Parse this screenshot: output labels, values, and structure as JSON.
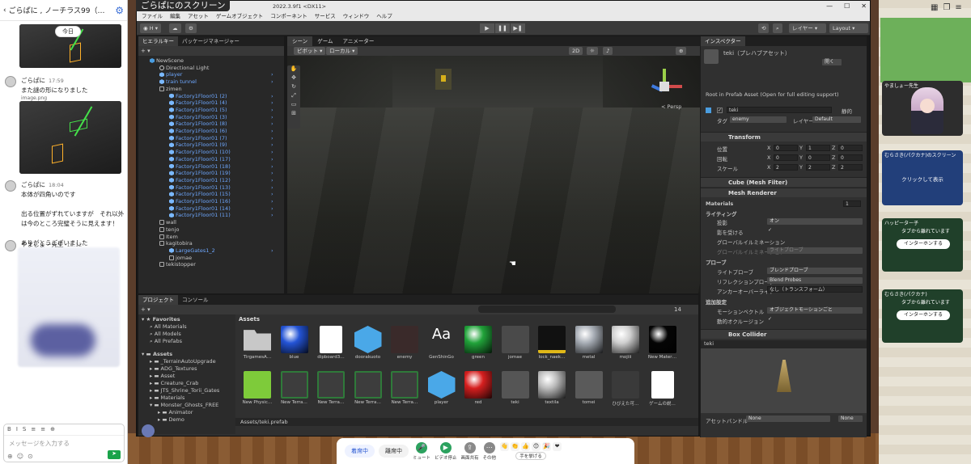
{
  "chat": {
    "title": "ごらぱに , ノーチラス99（…",
    "date_badge": "今日",
    "messages": [
      {
        "name": "ごらぱに",
        "time": "17:59",
        "text": "また謎の形になりました",
        "attachment": "image.png"
      },
      {
        "name": "ごらぱに",
        "time": "18:04",
        "text": "本体が四角いのです\n\n出る位置がずれていますが　それ以外は今のところ完璧そうに見えます！\n\nありがとうございました"
      },
      {
        "name": "やましょー先生",
        "time": "18:12",
        "text": ""
      }
    ],
    "composer": {
      "placeholder": "メッセージを入力する",
      "toolbar": [
        "B",
        "I",
        "S",
        "≡",
        "≡",
        "⊕"
      ]
    }
  },
  "screen_share_label": "ごらぱにのスクリーン",
  "unity": {
    "title": "2022.3.9f1 <DX11>",
    "menu": [
      "ファイル",
      "編集",
      "アセット",
      "ゲームオブジェクト",
      "コンポーネント",
      "サービス",
      "ウィンドウ",
      "ヘルプ"
    ],
    "toolbar": {
      "account": "H",
      "layers": "レイヤー",
      "layout": "Layout"
    },
    "hierarchy": {
      "tab": "ヒエラルキー",
      "tab2": "パッケージマネージャー",
      "rows": [
        {
          "text": "NewScene",
          "icon": "cube",
          "indent": 0,
          "color": "white"
        },
        {
          "text": "Directional Light",
          "icon": "light",
          "indent": 1,
          "color": "white"
        },
        {
          "text": "player",
          "icon": "prefab",
          "indent": 1,
          "color": "blue"
        },
        {
          "text": "train tunnel",
          "icon": "prefab",
          "indent": 1,
          "color": "blue"
        },
        {
          "text": "zimen",
          "icon": "go",
          "indent": 1,
          "color": "white"
        },
        {
          "text": "Factory1Floor01 (2)",
          "icon": "prefab",
          "indent": 2,
          "color": "blue"
        },
        {
          "text": "Factory1Floor01 (4)",
          "icon": "prefab",
          "indent": 2,
          "color": "blue"
        },
        {
          "text": "Factory1Floor01 (5)",
          "icon": "prefab",
          "indent": 2,
          "color": "blue"
        },
        {
          "text": "Factory1Floor01 (3)",
          "icon": "prefab",
          "indent": 2,
          "color": "blue"
        },
        {
          "text": "Factory1Floor01 (8)",
          "icon": "prefab",
          "indent": 2,
          "color": "blue"
        },
        {
          "text": "Factory1Floor01 (6)",
          "icon": "prefab",
          "indent": 2,
          "color": "blue"
        },
        {
          "text": "Factory1Floor01 (7)",
          "icon": "prefab",
          "indent": 2,
          "color": "blue"
        },
        {
          "text": "Factory1Floor01 (9)",
          "icon": "prefab",
          "indent": 2,
          "color": "blue"
        },
        {
          "text": "Factory1Floor01 (10)",
          "icon": "prefab",
          "indent": 2,
          "color": "blue"
        },
        {
          "text": "Factory1Floor01 (17)",
          "icon": "prefab",
          "indent": 2,
          "color": "blue"
        },
        {
          "text": "Factory1Floor01 (18)",
          "icon": "prefab",
          "indent": 2,
          "color": "blue"
        },
        {
          "text": "Factory1Floor01 (19)",
          "icon": "prefab",
          "indent": 2,
          "color": "blue"
        },
        {
          "text": "Factory1Floor01 (12)",
          "icon": "prefab",
          "indent": 2,
          "color": "blue"
        },
        {
          "text": "Factory1Floor01 (13)",
          "icon": "prefab",
          "indent": 2,
          "color": "blue"
        },
        {
          "text": "Factory1Floor01 (15)",
          "icon": "prefab",
          "indent": 2,
          "color": "blue"
        },
        {
          "text": "Factory1Floor01 (16)",
          "icon": "prefab",
          "indent": 2,
          "color": "blue"
        },
        {
          "text": "Factory1Floor01 (14)",
          "icon": "prefab",
          "indent": 2,
          "color": "blue"
        },
        {
          "text": "Factory1Floor01 (11)",
          "icon": "prefab",
          "indent": 2,
          "color": "blue"
        },
        {
          "text": "wall",
          "icon": "go",
          "indent": 1,
          "color": "white"
        },
        {
          "text": "tenjo",
          "icon": "go",
          "indent": 1,
          "color": "white"
        },
        {
          "text": "Item",
          "icon": "go",
          "indent": 1,
          "color": "white"
        },
        {
          "text": "kagitobira",
          "icon": "go",
          "indent": 1,
          "color": "white"
        },
        {
          "text": "LargeGates1_2",
          "icon": "prefab",
          "indent": 2,
          "color": "blue"
        },
        {
          "text": "jomae",
          "icon": "go",
          "indent": 2,
          "color": "white"
        },
        {
          "text": "tekistopper",
          "icon": "go",
          "indent": 1,
          "color": "white"
        }
      ]
    },
    "scene": {
      "tab": "シーン",
      "tab2": "ゲーム",
      "tab3": "アニメーター",
      "pivot": "ピボット",
      "local": "ローカル",
      "mode": "2D",
      "persp": "< Persp"
    },
    "inspector": {
      "tab": "インスペクター",
      "asset_name": "teki（プレハブアセット）",
      "open_btn": "開く",
      "root_note": "Root in Prefab Asset (Open for full editing support)",
      "object_name": "teki",
      "static": "静的",
      "tag_label": "タグ",
      "tag_value": "enemy",
      "layer_label": "レイヤー",
      "layer_value": "Default",
      "transform": {
        "title": "Transform",
        "rows": [
          {
            "label": "位置",
            "x": "0",
            "y": "1",
            "z": "0"
          },
          {
            "label": "回転",
            "x": "0",
            "y": "0",
            "z": "0"
          },
          {
            "label": "スケール",
            "x": "2",
            "y": "2",
            "z": "2"
          }
        ]
      },
      "mesh_filter": "Cube (Mesh Filter)",
      "mesh_renderer": "Mesh Renderer",
      "materials_label": "Materials",
      "materials_count": "1",
      "lighting_label": "ライティング",
      "cast_shadows": {
        "label": "投影",
        "value": "オン"
      },
      "receive_shadows": "影を受ける",
      "gi_label": "グローバルイルミネーション",
      "gi_label2": "グローバルイルミネーション",
      "gi_value": "ライトプローブ",
      "probes_label": "プローブ",
      "light_probes": {
        "label": "ライトプローブ",
        "value": "ブレンドプローブ"
      },
      "reflection_probes": {
        "label": "リフレクションプローブ",
        "value": "Blend Probes"
      },
      "anchor": {
        "label": "アンカーオーバーライド",
        "value": "なし（トランスフォーム）"
      },
      "additional_label": "追加設定",
      "motion_vectors": {
        "label": "モーションベクトル",
        "value": "オブジェクトモーションごと"
      },
      "dynamic_occlusion": "動的オクルージョン",
      "box_collider": "Box Collider",
      "preview_name": "teki",
      "asset_bundle": {
        "label": "アセットバンドル",
        "value": "None",
        "value2": "None"
      }
    },
    "project": {
      "tab": "プロジェクト",
      "tab2": "コンソール",
      "count": "14",
      "favorites": "Favorites",
      "fav_items": [
        "All Materials",
        "All Models",
        "All Prefabs"
      ],
      "assets_root": "Assets",
      "folders": [
        "_TerrainAutoUpgrade",
        "ADG_Textures",
        "Asset",
        "Creature_Crab",
        "JTS_Shrine_Torii_Gates",
        "Materials",
        "Monster_Ghosts_FREE",
        "Animator",
        "Demo"
      ],
      "breadcrumb": "Assets",
      "grid": [
        {
          "name": "TirgamesA…",
          "kind": "folder",
          "color": "#c8c8c8"
        },
        {
          "name": "blue",
          "kind": "ball",
          "color": "#2454d6"
        },
        {
          "name": "dipboard3…",
          "kind": "paper",
          "color": "#ffffff"
        },
        {
          "name": "doorakuoto",
          "kind": "cube",
          "color": "#4aa8e8"
        },
        {
          "name": "enemy",
          "kind": "dark",
          "color": "#3a2a2a"
        },
        {
          "name": "GenShinGo",
          "kind": "font",
          "color": "#303030"
        },
        {
          "name": "green",
          "kind": "ball",
          "color": "#21a33a"
        },
        {
          "name": "jomae",
          "kind": "dark",
          "color": "#4a4a4a"
        },
        {
          "name": "lock_naek…",
          "kind": "lock",
          "color": "#111111"
        },
        {
          "name": "metal",
          "kind": "ball",
          "color": "#a7adb5"
        },
        {
          "name": "mojiii",
          "kind": "ball",
          "color": "#cfcfcf"
        },
        {
          "name": "New Mater…",
          "kind": "ball",
          "color": "#050505"
        },
        {
          "name": "New Physic…",
          "kind": "physic",
          "color": "#7ecb3a"
        },
        {
          "name": "New Terra…",
          "kind": "terrain",
          "color": "#2f7a3a"
        },
        {
          "name": "New Terra…",
          "kind": "terrain",
          "color": "#2f7a3a"
        },
        {
          "name": "New Terra…",
          "kind": "terrain",
          "color": "#2f7a3a"
        },
        {
          "name": "New Terra…",
          "kind": "terrain",
          "color": "#2f7a3a"
        },
        {
          "name": "player",
          "kind": "cube",
          "color": "#4aa8e8"
        },
        {
          "name": "red",
          "kind": "ball",
          "color": "#d61f1f"
        },
        {
          "name": "teki",
          "kind": "teki",
          "color": "#8a8a8a"
        },
        {
          "name": "textila",
          "kind": "ball",
          "color": "#bcbcbc"
        },
        {
          "name": "tomei",
          "kind": "dark",
          "color": "#5a5a5a"
        },
        {
          "name": "ひびえた可…",
          "kind": "dark",
          "color": "#3a3a3a"
        },
        {
          "name": "ゲームの説…",
          "kind": "paper",
          "color": "#ffffff"
        }
      ],
      "path": "Assets/teki.prefab"
    }
  },
  "right_panel": {
    "tiles": [
      {
        "label": "やましょー先生",
        "kind": "video"
      },
      {
        "label": "むらさき(パクカナ)のスクリーン",
        "kind": "blue",
        "center": "クリックして表示"
      },
      {
        "label": "ハッピーター子",
        "kind": "away",
        "away": "タブから離れています",
        "button": "インターホンする"
      },
      {
        "label": "むらさき(パクカナ)",
        "kind": "away",
        "away": "タブから離れています",
        "button": "インターホンする"
      }
    ]
  },
  "zoom_bar": {
    "seat_btn": "着席中",
    "sit_btn": "離席中",
    "mute": "ミュート",
    "video": "ビデオ停止",
    "share": "画面共有",
    "more": "その他",
    "raise": "手を挙げる",
    "emojis": [
      "👋",
      "👏",
      "👍",
      "😊",
      "🎉",
      "❤"
    ]
  }
}
